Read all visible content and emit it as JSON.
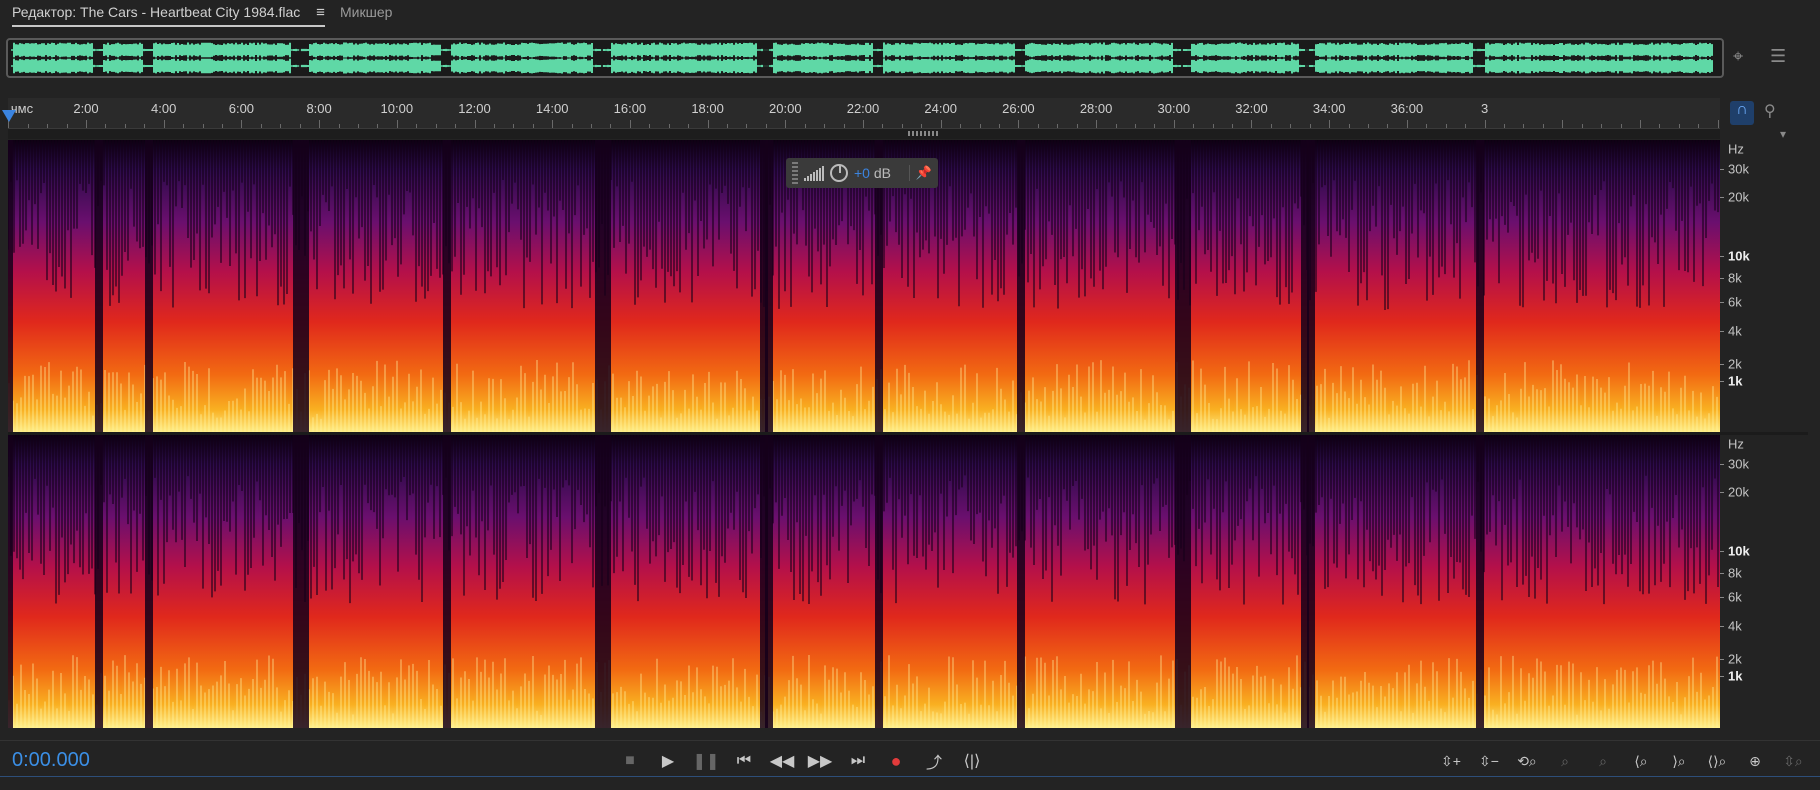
{
  "tabs": [
    {
      "label": "Редактор: The Cars - Heartbeat City 1984.flac",
      "active": true,
      "menu_glyph": "≡"
    },
    {
      "label": "Микшер",
      "active": false
    }
  ],
  "ruler": {
    "unit_label": "чмс",
    "labels": [
      "2:00",
      "4:00",
      "6:00",
      "8:00",
      "10:00",
      "12:00",
      "14:00",
      "16:00",
      "18:00",
      "20:00",
      "22:00",
      "24:00",
      "26:00",
      "28:00",
      "30:00",
      "32:00",
      "34:00",
      "36:00",
      "3"
    ]
  },
  "hz_scale": [
    {
      "label": "Hz",
      "bold": false
    },
    {
      "label": "30k",
      "bold": false
    },
    {
      "label": "20k",
      "bold": false
    },
    {
      "label": "10k",
      "bold": true
    },
    {
      "label": "8k",
      "bold": false
    },
    {
      "label": "6k",
      "bold": false
    },
    {
      "label": "4k",
      "bold": false
    },
    {
      "label": "2k",
      "bold": false
    },
    {
      "label": "1k",
      "bold": true
    }
  ],
  "hud": {
    "gain_value": "+0",
    "gain_unit": "dB"
  },
  "time_display": "0:00.000",
  "transport": [
    {
      "name": "stop-button",
      "glyph": "■",
      "dim": true
    },
    {
      "name": "play-button",
      "glyph": "▶",
      "dim": false
    },
    {
      "name": "pause-button",
      "glyph": "❚❚",
      "dim": true
    },
    {
      "name": "go-to-start-button",
      "glyph": "⏮",
      "dim": false
    },
    {
      "name": "rewind-button",
      "glyph": "◀◀",
      "dim": false
    },
    {
      "name": "fast-forward-button",
      "glyph": "▶▶",
      "dim": false
    },
    {
      "name": "go-to-end-button",
      "glyph": "⏭",
      "dim": false
    },
    {
      "name": "record-button",
      "glyph": "●",
      "dim": false
    },
    {
      "name": "loop-button",
      "glyph": "⤴",
      "dim": false
    },
    {
      "name": "skip-selection-button",
      "glyph": "⟨|⟩",
      "dim": false
    }
  ],
  "zoom": [
    {
      "name": "zoom-in-amplitude-button",
      "glyph": "⇳+",
      "dim": false
    },
    {
      "name": "zoom-out-amplitude-button",
      "glyph": "⇳−",
      "dim": false
    },
    {
      "name": "zoom-reset-button",
      "glyph": "⟲⌕",
      "dim": false
    },
    {
      "name": "zoom-to-selection-button",
      "glyph": "⌕",
      "dim": true
    },
    {
      "name": "zoom-to-selected-clip-button",
      "glyph": "⌕",
      "dim": true
    },
    {
      "name": "zoom-in-time-button",
      "glyph": "⟨⌕",
      "dim": false
    },
    {
      "name": "zoom-out-time-button",
      "glyph": "⟩⌕",
      "dim": false
    },
    {
      "name": "zoom-full-button",
      "glyph": "⟨⟩⌕",
      "dim": false
    },
    {
      "name": "zoom-in-point-button",
      "glyph": "⊕",
      "dim": false
    },
    {
      "name": "zoom-out-full-button",
      "glyph": "⇳⌕",
      "dim": true
    }
  ],
  "colors": {
    "accent": "#3b84e0",
    "waveform": "#5fd8a6",
    "record": "#e23b3b"
  }
}
